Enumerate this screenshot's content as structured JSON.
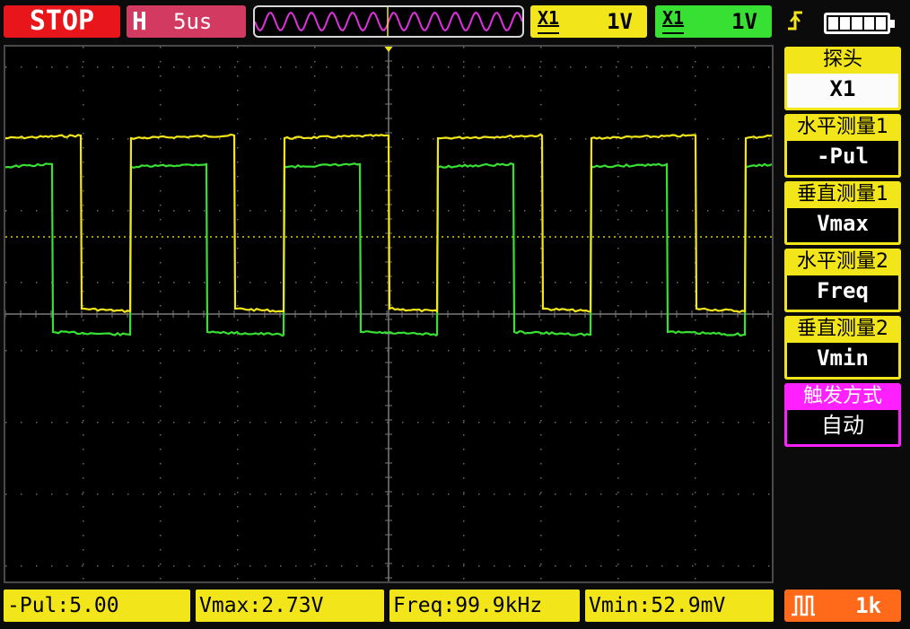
{
  "status": {
    "run_state": "STOP"
  },
  "timebase": {
    "letter": "H",
    "value": "5us"
  },
  "channels": [
    {
      "symbol": "X1",
      "volts": "1V",
      "color": "#f2e51a"
    },
    {
      "symbol": "X1",
      "volts": "1V",
      "color": "#37e032"
    }
  ],
  "icons": {
    "trigger": "trigger-edge-icon",
    "battery": "battery-icon",
    "pulse": "pulse-wave-icon"
  },
  "menu": [
    {
      "title": "探头",
      "value": "X1"
    },
    {
      "title": "水平测量1",
      "value": "-Pul"
    },
    {
      "title": "垂直测量1",
      "value": "Vmax"
    },
    {
      "title": "水平测量2",
      "value": "Freq"
    },
    {
      "title": "垂直测量2",
      "value": "Vmin"
    },
    {
      "title": "触发方式",
      "value": "自动"
    }
  ],
  "measurements": [
    "-Pul:5.00",
    "Vmax:2.73V",
    "Freq:99.9kHz",
    "Vmin:52.9mV"
  ],
  "counter": {
    "value": "1k"
  },
  "colors": {
    "ch1": "#f2e51a",
    "ch2": "#37e032",
    "stop": "#e8151b",
    "timebase": "#d23a62",
    "trigger_menu": "#ff20ff",
    "counter": "#ff6a1a"
  }
}
